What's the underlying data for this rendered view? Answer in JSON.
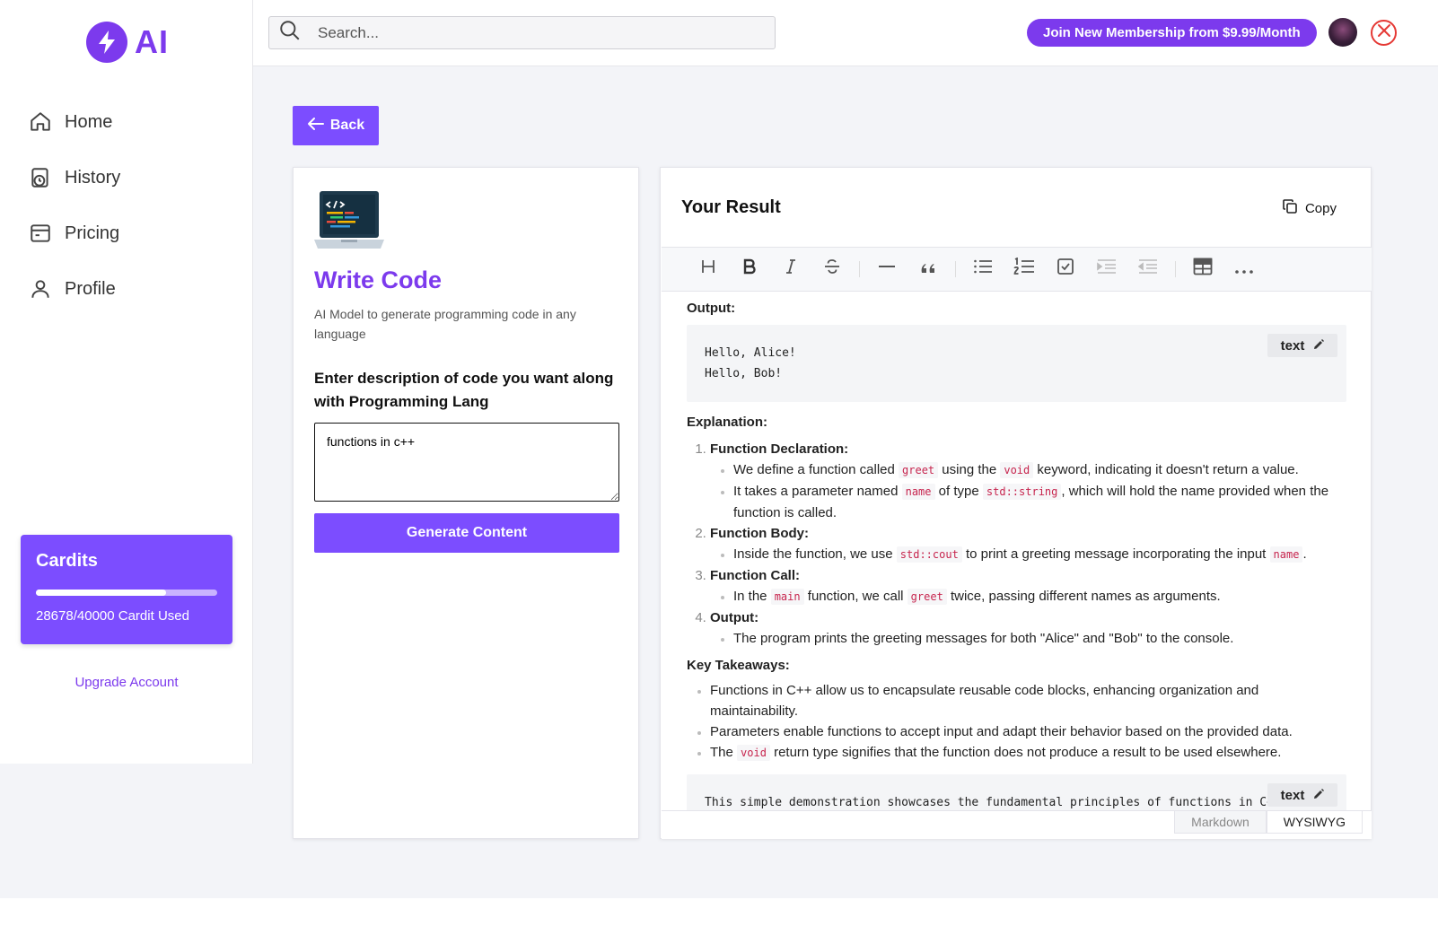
{
  "app": {
    "logo_text": "AI",
    "brand_color": "#7c3aed"
  },
  "sidebar": {
    "items": [
      {
        "label": "Home",
        "icon": "home-icon"
      },
      {
        "label": "History",
        "icon": "history-icon"
      },
      {
        "label": "Pricing",
        "icon": "pricing-icon"
      },
      {
        "label": "Profile",
        "icon": "profile-icon"
      }
    ],
    "credits": {
      "title": "Cardits",
      "used": 28678,
      "total": 40000,
      "usage_fraction": 0.717,
      "text": "28678/40000 Cardit Used"
    },
    "upgrade_label": "Upgrade Account"
  },
  "header": {
    "search_placeholder": "Search...",
    "membership_label": "Join New Membership from $9.99/Month"
  },
  "main": {
    "back_label": "Back",
    "tool": {
      "title": "Write Code",
      "description": "AI Model to generate programming code in any language",
      "prompt_label": "Enter description of code you want along with Programming Lang",
      "input_value": "functions in c++",
      "generate_label": "Generate Content"
    },
    "result": {
      "title": "Your Result",
      "copy_label": "Copy",
      "output_heading": "Output:",
      "code_lang": "text",
      "output_lines": [
        "Hello, Alice!",
        "Hello, Bob!"
      ],
      "explanation_heading": "Explanation:",
      "explanation": [
        {
          "title": "Function Declaration:",
          "points": [
            {
              "parts": [
                "We define a function called ",
                "greet",
                " using the ",
                "void",
                " keyword, indicating it doesn't return a value."
              ]
            },
            {
              "parts": [
                "It takes a parameter named ",
                "name",
                " of type ",
                "std::string",
                ", which will hold the name provided when the function is called."
              ]
            }
          ]
        },
        {
          "title": "Function Body:",
          "points": [
            {
              "parts": [
                "Inside the function, we use ",
                "std::cout",
                " to print a greeting message incorporating the input ",
                "name",
                "."
              ]
            }
          ]
        },
        {
          "title": "Function Call:",
          "points": [
            {
              "parts": [
                "In the ",
                "main",
                " function, we call ",
                "greet",
                " twice, passing different names as arguments."
              ]
            }
          ]
        },
        {
          "title": "Output:",
          "points": [
            {
              "parts": [
                "The program prints the greeting messages for both \"Alice\" and \"Bob\" to the console."
              ]
            }
          ]
        }
      ],
      "takeaways_heading": "Key Takeaways:",
      "takeaways": [
        {
          "parts": [
            "Functions in C++ allow us to encapsulate reusable code blocks, enhancing organization and maintainability."
          ]
        },
        {
          "parts": [
            "Parameters enable functions to accept input and adapt their behavior based on the provided data."
          ]
        },
        {
          "parts": [
            "The ",
            "void",
            " return type signifies that the function does not produce a result to be used elsewhere."
          ]
        }
      ],
      "closing_code": "This simple demonstration showcases the fundamental principles of functions in C++.",
      "closing_code_lang": "text",
      "mode_tabs": {
        "markdown": "Markdown",
        "wysiwyg": "WYSIWYG"
      }
    }
  }
}
